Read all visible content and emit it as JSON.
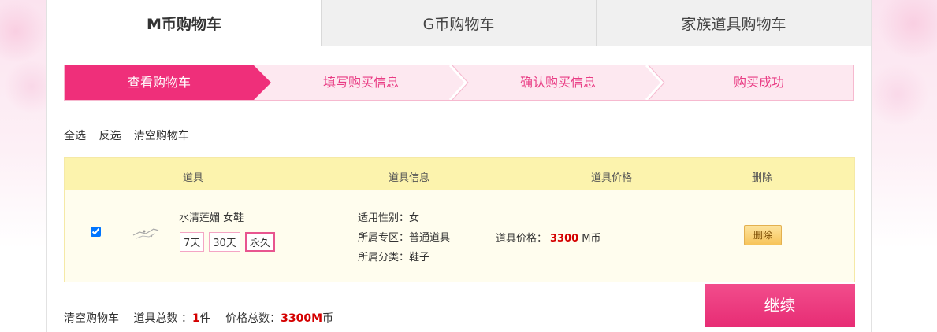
{
  "tabs": [
    {
      "label": "M币购物车",
      "active": true
    },
    {
      "label": "G币购物车",
      "active": false
    },
    {
      "label": "家族道具购物车",
      "active": false
    }
  ],
  "steps": [
    "查看购物车",
    "填写购买信息",
    "确认购买信息",
    "购买成功"
  ],
  "actions": {
    "select_all": "全选",
    "invert": "反选",
    "clear_cart": "清空购物车"
  },
  "table": {
    "headers": {
      "item": "道具",
      "info": "道具信息",
      "price": "道具价格",
      "delete": "删除"
    },
    "rows": [
      {
        "checked": true,
        "name": "水清莲媚 女鞋",
        "durations": [
          "7天",
          "30天",
          "永久"
        ],
        "selected_duration": "永久",
        "gender": "适用性别：女",
        "zone": "所属专区：普通道具",
        "category": "所属分类：鞋子",
        "price_label": "道具价格：",
        "price_value": "3300",
        "price_unit": "M币",
        "delete_label": "删除"
      }
    ]
  },
  "summary": {
    "clear_cart": "清空购物车",
    "count_label": "道具总数 ：",
    "count_value": "1",
    "count_unit": "件",
    "total_label": "价格总数：",
    "total_value": "3300M",
    "total_unit": "币"
  },
  "continue_label": "继续",
  "colors": {
    "accent": "#ef2f7a",
    "step_bg": "#fde8f0",
    "header_bg": "#fcf3ad",
    "price_red": "#d40000"
  }
}
